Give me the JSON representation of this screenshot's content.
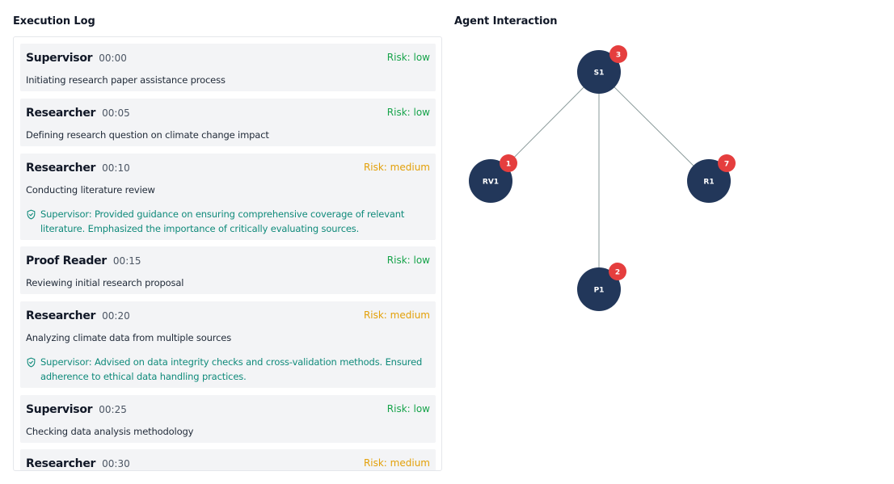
{
  "execution_log": {
    "title": "Execution Log",
    "entries": [
      {
        "agent": "Supervisor",
        "time": "00:00",
        "risk": "Risk: low",
        "risk_level": "low",
        "description": "Initiating research paper assistance process"
      },
      {
        "agent": "Researcher",
        "time": "00:05",
        "risk": "Risk: low",
        "risk_level": "low",
        "description": "Defining research question on climate change impact"
      },
      {
        "agent": "Researcher",
        "time": "00:10",
        "risk": "Risk: medium",
        "risk_level": "medium",
        "description": "Conducting literature review",
        "feedback": "Supervisor: Provided guidance on ensuring comprehensive coverage of relevant literature. Emphasized the importance of critically evaluating sources."
      },
      {
        "agent": "Proof Reader",
        "time": "00:15",
        "risk": "Risk: low",
        "risk_level": "low",
        "description": "Reviewing initial research proposal"
      },
      {
        "agent": "Researcher",
        "time": "00:20",
        "risk": "Risk: medium",
        "risk_level": "medium",
        "description": "Analyzing climate data from multiple sources",
        "feedback": "Supervisor: Advised on data integrity checks and cross-validation methods. Ensured adherence to ethical data handling practices."
      },
      {
        "agent": "Supervisor",
        "time": "00:25",
        "risk": "Risk: low",
        "risk_level": "low",
        "description": "Checking data analysis methodology"
      },
      {
        "agent": "Researcher",
        "time": "00:30",
        "risk": "Risk: medium",
        "risk_level": "medium",
        "description": ""
      }
    ]
  },
  "agent_interaction": {
    "title": "Agent Interaction",
    "nodes": [
      {
        "id": "S1",
        "label": "S1",
        "count": "3"
      },
      {
        "id": "RV1",
        "label": "RV1",
        "count": "1"
      },
      {
        "id": "R1",
        "label": "R1",
        "count": "7"
      },
      {
        "id": "P1",
        "label": "P1",
        "count": "2"
      }
    ],
    "edges": [
      {
        "from": "S1",
        "to": "RV1"
      },
      {
        "from": "S1",
        "to": "R1"
      },
      {
        "from": "S1",
        "to": "P1"
      }
    ]
  },
  "colors": {
    "risk_low": "#16a34a",
    "risk_medium": "#e3a008",
    "feedback": "#0f8a7a",
    "node_fill": "#22375a",
    "badge_fill": "#e53e3e",
    "edge": "#8a9a9a",
    "entry_bg": "#f3f4f6"
  },
  "icons": {
    "feedback_icon": "shield-check-icon"
  }
}
